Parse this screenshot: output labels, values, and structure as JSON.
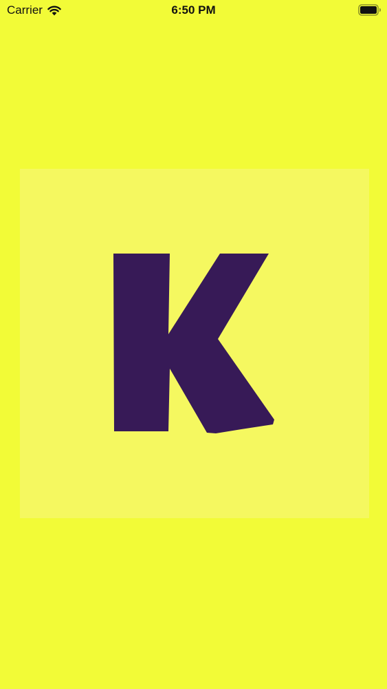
{
  "status_bar": {
    "carrier": "Carrier",
    "time": "6:50 PM",
    "icons": {
      "wifi": "wifi-icon",
      "battery": "battery-icon"
    }
  },
  "splash": {
    "logo_letter": "K",
    "logo_icon": "k-logo-icon"
  },
  "colors": {
    "background": "#F2FB37",
    "tile": "#F5F860",
    "letter": "#371A57",
    "status_text": "#111111"
  }
}
